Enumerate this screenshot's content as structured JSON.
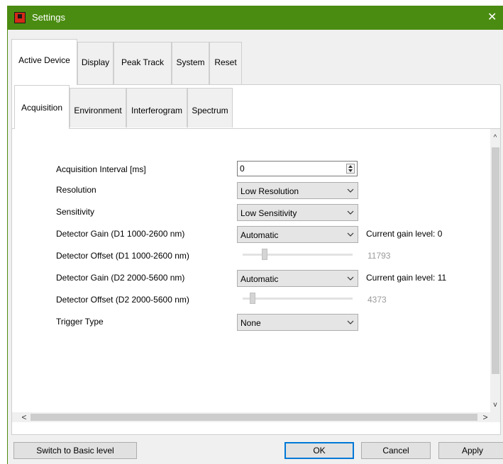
{
  "window": {
    "title": "Settings",
    "close_glyph": "✕"
  },
  "outer_tabs": [
    {
      "label": "Active Device",
      "active": true
    },
    {
      "label": "Display"
    },
    {
      "label": "Peak Track"
    },
    {
      "label": "System"
    },
    {
      "label": "Reset"
    }
  ],
  "inner_tabs": [
    {
      "label": "Acquisition",
      "active": true
    },
    {
      "label": "Environment"
    },
    {
      "label": "Interferogram"
    },
    {
      "label": "Spectrum"
    }
  ],
  "acquisition": {
    "interval_label": "Acquisition Interval [ms]",
    "interval_value": "0",
    "resolution_label": "Resolution",
    "resolution_value": "Low Resolution",
    "sensitivity_label": "Sensitivity",
    "sensitivity_value": "Low Sensitivity",
    "gain_d1_label": "Detector Gain (D1 1000-2600 nm)",
    "gain_d1_value": "Automatic",
    "gain_d1_current": "Current gain level: 0",
    "offset_d1_label": "Detector Offset (D1 1000-2600 nm)",
    "offset_d1_value": "11793",
    "gain_d2_label": "Detector Gain (D2 2000-5600 nm)",
    "gain_d2_value": "Automatic",
    "gain_d2_current": "Current gain level: 11",
    "offset_d2_label": "Detector Offset (D2 2000-5600 nm)",
    "offset_d2_value": "4373",
    "trigger_label": "Trigger Type",
    "trigger_value": "None"
  },
  "scroll": {
    "up": "^",
    "down": "v",
    "left": "<",
    "right": ">"
  },
  "footer": {
    "switch_label": "Switch to Basic level",
    "ok_label": "OK",
    "cancel_label": "Cancel",
    "apply_label": "Apply"
  },
  "colors": {
    "titlebar": "#4a8c11",
    "accent": "#0078d7"
  },
  "icons": {
    "app": "app-icon",
    "close": "close-icon",
    "chevron": "chevron-down-icon"
  }
}
